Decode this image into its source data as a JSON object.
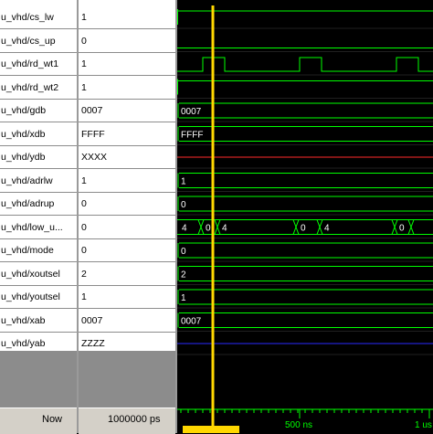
{
  "signals": [
    {
      "name": "u_vhd/cs_lw",
      "value": "1"
    },
    {
      "name": "u_vhd/cs_up",
      "value": "0"
    },
    {
      "name": "u_vhd/rd_wt1",
      "value": "1"
    },
    {
      "name": "u_vhd/rd_wt2",
      "value": "1"
    },
    {
      "name": "u_vhd/gdb",
      "value": "0007"
    },
    {
      "name": "u_vhd/xdb",
      "value": "FFFF"
    },
    {
      "name": "u_vhd/ydb",
      "value": "XXXX"
    },
    {
      "name": "u_vhd/adrlw",
      "value": "1"
    },
    {
      "name": "u_vhd/adrup",
      "value": "0"
    },
    {
      "name": "u_vhd/low_u...",
      "value": "0"
    },
    {
      "name": "u_vhd/mode",
      "value": "0"
    },
    {
      "name": "u_vhd/xoutsel",
      "value": "2"
    },
    {
      "name": "u_vhd/youtsel",
      "value": "1"
    },
    {
      "name": "u_vhd/xab",
      "value": "0007"
    },
    {
      "name": "u_vhd/yab",
      "value": "ZZZZ"
    }
  ],
  "wave_labels": {
    "gdb": "0007",
    "xdb": "FFFF",
    "adrlw": "1",
    "adrup": "0",
    "low_u": [
      "4",
      "0",
      "4",
      "0",
      "4",
      "0"
    ],
    "mode": "0",
    "xoutsel": "2",
    "youtsel": "1",
    "xab": "0007"
  },
  "footer": {
    "now_label": "Now",
    "now_value": "1000000 ps"
  },
  "timeline": {
    "tick_mid": "500 ns",
    "tick_end": "1 us"
  },
  "colors": {
    "wave_high": "#00ff00",
    "cursor": "#ffd700",
    "ydb": "#ff2a2a",
    "yab": "#2a2aff"
  }
}
